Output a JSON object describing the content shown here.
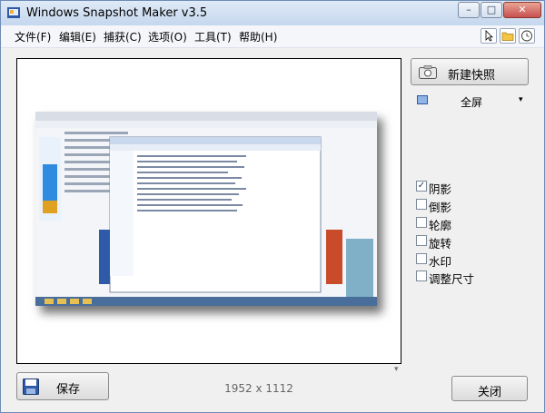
{
  "window": {
    "title": "Windows Snapshot Maker v3.5"
  },
  "titlebar_buttons": {
    "minimize": "–",
    "maximize": "□",
    "close": "✕"
  },
  "menu": [
    "文件(F)",
    "编辑(E)",
    "捕获(C)",
    "选项(O)",
    "工具(T)",
    "帮助(H)"
  ],
  "toolbar_icons": [
    "cursor-icon",
    "folder-icon",
    "clock-icon"
  ],
  "preview": {
    "dimensions": "1952 x 1112"
  },
  "actions": {
    "new_snapshot": "新建快照",
    "save": "保存",
    "close": "关闭"
  },
  "capture_mode": {
    "selected": "全屏",
    "arrow": "▾"
  },
  "options": [
    {
      "label": "阴影",
      "checked": true
    },
    {
      "label": "倒影",
      "checked": false
    },
    {
      "label": "轮廓",
      "checked": false
    },
    {
      "label": "旋转",
      "checked": false
    },
    {
      "label": "水印",
      "checked": false
    },
    {
      "label": "调整尺寸",
      "checked": false
    }
  ],
  "colors": {
    "accent": "#2e5aa8",
    "frame": "#6d8cb5"
  }
}
